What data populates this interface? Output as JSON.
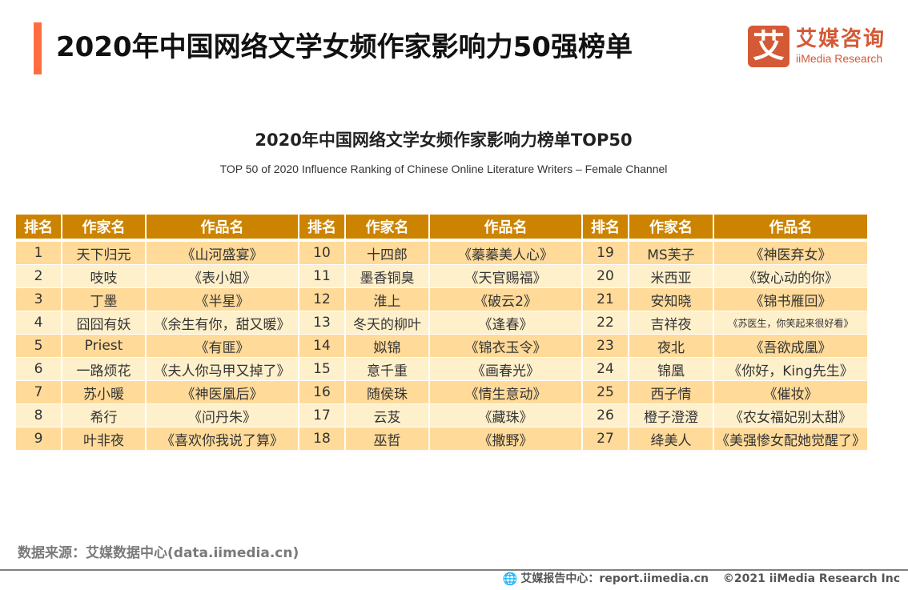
{
  "header": {
    "title": "2020年中国网络文学女频作家影响力50强榜单",
    "accent_color": "#FF6E40"
  },
  "logo": {
    "mark": "艾",
    "name_cn": "艾媒咨询",
    "name_en": "iiMedia Research",
    "color": "#D45A35"
  },
  "chart_data": {
    "type": "table",
    "title": "2020年中国网络文学女频作家影响力榜单TOP50",
    "subtitle": "TOP 50 of 2020 Influence Ranking of Chinese Online Literature Writers – Female Channel",
    "columns": [
      "排名",
      "作家名",
      "作品名"
    ],
    "header_color": "#CC8400",
    "row_colors": [
      "#FFDA99",
      "#FFF0CC"
    ],
    "groups": [
      {
        "rows": [
          {
            "rank": "1",
            "author": "天下归元",
            "work": "《山河盛宴》"
          },
          {
            "rank": "2",
            "author": "吱吱",
            "work": "《表小姐》"
          },
          {
            "rank": "3",
            "author": "丁墨",
            "work": "《半星》"
          },
          {
            "rank": "4",
            "author": "囧囧有妖",
            "work": "《余生有你，甜又暖》"
          },
          {
            "rank": "5",
            "author": "Priest",
            "work": "《有匪》"
          },
          {
            "rank": "6",
            "author": "一路烦花",
            "work": "《夫人你马甲又掉了》"
          },
          {
            "rank": "7",
            "author": "苏小暖",
            "work": "《神医凰后》"
          },
          {
            "rank": "8",
            "author": "希行",
            "work": "《问丹朱》"
          },
          {
            "rank": "9",
            "author": "叶非夜",
            "work": "《喜欢你我说了算》"
          }
        ]
      },
      {
        "rows": [
          {
            "rank": "10",
            "author": "十四郎",
            "work": "《蓁蓁美人心》"
          },
          {
            "rank": "11",
            "author": "墨香铜臭",
            "work": "《天官赐福》"
          },
          {
            "rank": "12",
            "author": "淮上",
            "work": "《破云2》"
          },
          {
            "rank": "13",
            "author": "冬天的柳叶",
            "work": "《逢春》"
          },
          {
            "rank": "14",
            "author": "姒锦",
            "work": "《锦衣玉令》"
          },
          {
            "rank": "15",
            "author": "意千重",
            "work": "《画春光》"
          },
          {
            "rank": "16",
            "author": "随侯珠",
            "work": "《情生意动》"
          },
          {
            "rank": "17",
            "author": "云芨",
            "work": "《藏珠》"
          },
          {
            "rank": "18",
            "author": "巫哲",
            "work": "《撒野》"
          }
        ]
      },
      {
        "rows": [
          {
            "rank": "19",
            "author": "MS芙子",
            "work": "《神医弃女》"
          },
          {
            "rank": "20",
            "author": "米西亚",
            "work": "《致心动的你》"
          },
          {
            "rank": "21",
            "author": "安知晓",
            "work": "《锦书雁回》"
          },
          {
            "rank": "22",
            "author": "吉祥夜",
            "work": "《苏医生，你笑起来很好看》"
          },
          {
            "rank": "23",
            "author": "夜北",
            "work": "《吾欲成凰》"
          },
          {
            "rank": "24",
            "author": "锦凰",
            "work": "《你好，King先生》"
          },
          {
            "rank": "25",
            "author": "西子情",
            "work": "《催妆》"
          },
          {
            "rank": "26",
            "author": "橙子澄澄",
            "work": "《农女福妃别太甜》"
          },
          {
            "rank": "27",
            "author": "绛美人",
            "work": "《美强惨女配她觉醒了》"
          }
        ]
      }
    ]
  },
  "footer": {
    "source": "数据来源：艾媒数据中心(data.iimedia.cn)",
    "report_center": "艾媒报告中心：report.iimedia.cn",
    "copyright": "©2021  iiMedia Research  Inc",
    "globe_icon": "🌐"
  }
}
